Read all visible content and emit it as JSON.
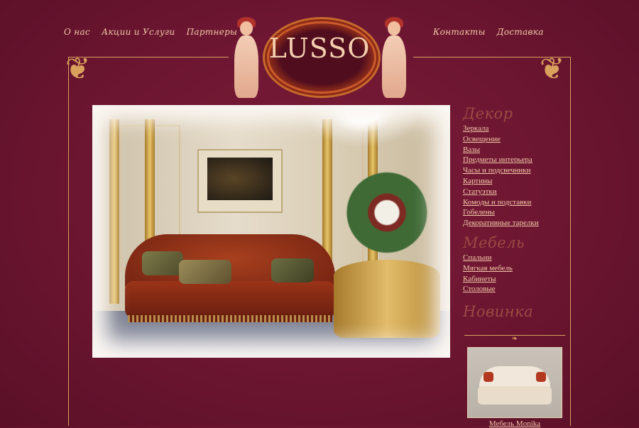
{
  "nav_left": [
    "О нас",
    "Акции и Услуги",
    "Партнеры"
  ],
  "nav_right": [
    "Контакты",
    "Доставка"
  ],
  "logo": "LUSSO",
  "sidebar": {
    "decor_title": "Декор",
    "decor_links": [
      "Зеркала",
      "Освещение",
      "Вазы",
      "Предметы интерьера",
      "Часы и подсвечники",
      "Картины",
      "Статуэтки",
      "Комоды и подставки",
      "Гобелены",
      "Декоративные тарелки"
    ],
    "furniture_title": "Мебель",
    "furniture_links": [
      "Спальни",
      "Мягкая мебель",
      "Кабинеты",
      "Столовые"
    ],
    "new_title": "Новинка",
    "new_caption": "Мебель Monika"
  },
  "colors": {
    "background": "#6e1630",
    "accent_gold": "#d9a15c",
    "link": "#f2c9a8",
    "section_title": "#9c4a44"
  }
}
